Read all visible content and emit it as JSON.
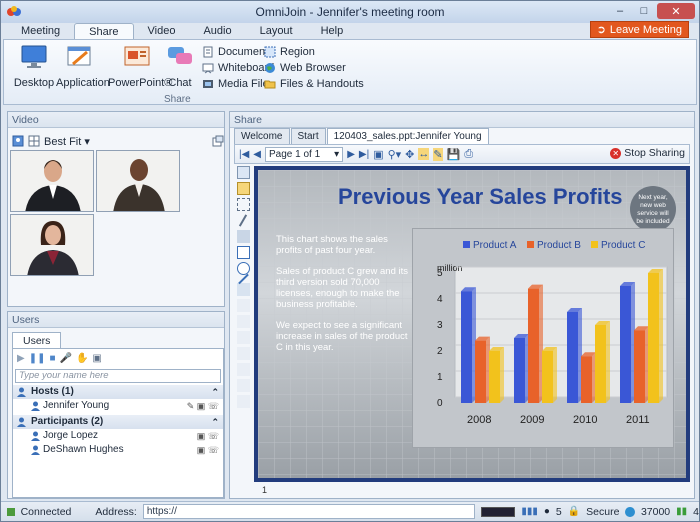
{
  "window": {
    "title": "OmniJoin - Jennifer's meeting room"
  },
  "menu": {
    "tabs": [
      "Meeting",
      "Share",
      "Video",
      "Audio",
      "Layout",
      "Help"
    ],
    "active": "Share"
  },
  "leave_button": "Leave Meeting",
  "ribbon": {
    "big": [
      "Desktop",
      "Application",
      "PowerPoint®",
      "Chat"
    ],
    "small": [
      "Document",
      "Whiteboard",
      "Media File",
      "Region",
      "Web Browser",
      "Files & Handouts"
    ],
    "group_label": "Share"
  },
  "video_panel": {
    "title": "Video",
    "fit": "Best Fit"
  },
  "users_panel": {
    "title": "Users",
    "tab": "Users",
    "search_placeholder": "Type your name here",
    "hosts_label": "Hosts (1)",
    "hosts": [
      "Jennifer Young"
    ],
    "participants_label": "Participants (2)",
    "participants": [
      "Jorge Lopez",
      "DeShawn Hughes"
    ]
  },
  "share_panel": {
    "title": "Share",
    "tabs": [
      "Welcome",
      "Start",
      "120403_sales.ppt:Jennifer Young"
    ],
    "page_select": "Page 1 of 1",
    "stop_sharing": "Stop Sharing",
    "page_number": "1"
  },
  "slide": {
    "title": "Previous Year Sales Profits",
    "bubble": "Next year, new web service will be included",
    "paragraphs": [
      "This chart shows the sales profits of past four year.",
      "Sales of product C grew and its third version sold 70,000 licenses, enough to make the business profitable.",
      "We expect to see a significant increase in sales of the product C in this year."
    ]
  },
  "chart_data": {
    "type": "bar",
    "categories": [
      "2008",
      "2009",
      "2010",
      "2011"
    ],
    "series": [
      {
        "name": "Product A",
        "values": [
          4.3,
          2.5,
          3.5,
          4.5
        ]
      },
      {
        "name": "Product B",
        "values": [
          2.4,
          4.4,
          1.8,
          2.8
        ]
      },
      {
        "name": "Product C",
        "values": [
          2.0,
          2.0,
          3.0,
          5.0
        ]
      }
    ],
    "ylabel": "million",
    "ylim": [
      0,
      5
    ],
    "yticks": [
      "0",
      "1",
      "2",
      "3",
      "4",
      "5"
    ],
    "colors": [
      "#3a57d6",
      "#e8622a",
      "#f2c21c"
    ]
  },
  "status": {
    "connected": "Connected",
    "address_label": "Address:",
    "address": "https://",
    "users_count": "5",
    "secure": "Secure",
    "points": "37000",
    "counter": "4"
  }
}
